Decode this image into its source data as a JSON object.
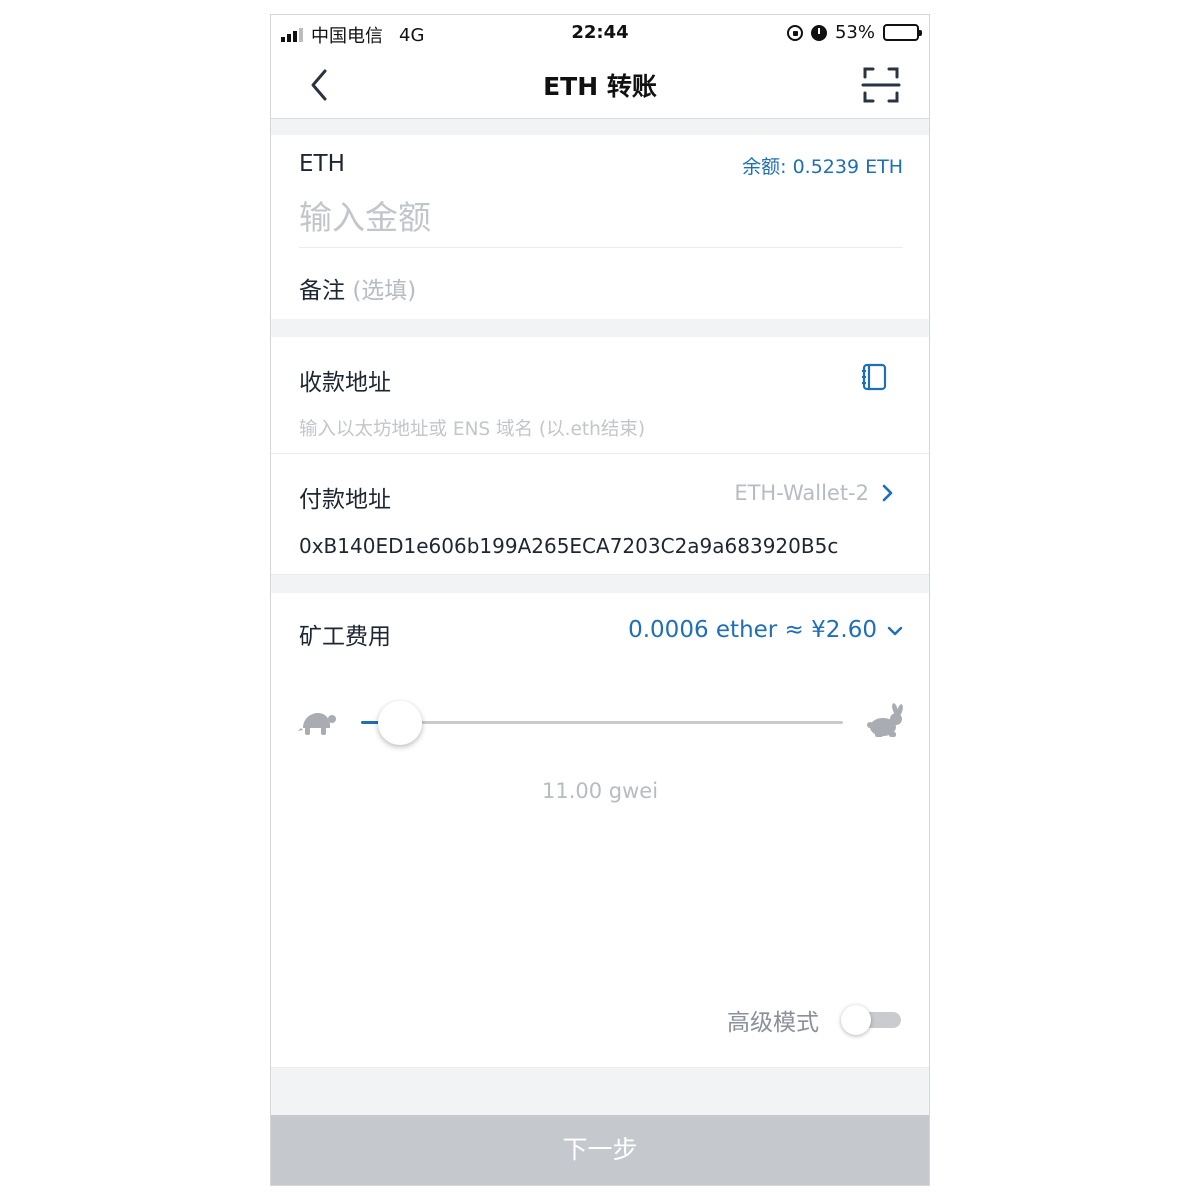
{
  "status_bar": {
    "carrier": "中国电信",
    "network": "4G",
    "time": "22:44",
    "battery": "53%",
    "battery_level": 0.53
  },
  "nav": {
    "title": "ETH 转账"
  },
  "amount": {
    "token": "ETH",
    "balance": "余额: 0.5239 ETH",
    "placeholder": "输入金额",
    "memo_label": "备注",
    "memo_placeholder": "(选填)"
  },
  "recipient": {
    "label": "收款地址",
    "placeholder": "输入以太坊地址或 ENS 域名 (以.eth结束)"
  },
  "payer": {
    "label": "付款地址",
    "wallet_name": "ETH-Wallet-2",
    "address": "0xB140ED1e606b199A265ECA7203C2a9a683920B5c"
  },
  "fee": {
    "label": "矿工费用",
    "value": "0.0006 ether ≈ ¥2.60",
    "gas_price": "11.00 gwei",
    "slider_fraction": 0.08
  },
  "advanced": {
    "label": "高级模式",
    "enabled": false
  },
  "footer": {
    "next_label": "下一步"
  },
  "colors": {
    "accent": "#1e6fb8",
    "button_disabled": "#c5c9cd",
    "section_gap": "#f2f3f5"
  }
}
